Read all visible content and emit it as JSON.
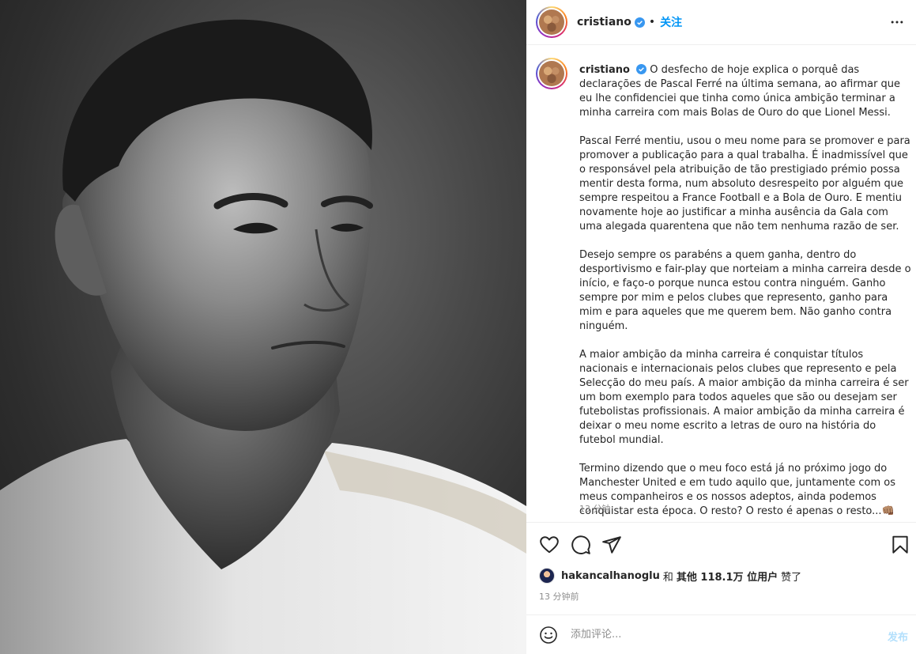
{
  "photo": {
    "alt_icon": "portrait-photo"
  },
  "header": {
    "username": "cristiano",
    "separator": "•",
    "follow_label": "关注",
    "more_icon": "more-horizontal-icon",
    "verified_icon": "verified-badge-icon"
  },
  "caption": {
    "username": "cristiano",
    "paragraphs": [
      "O desfecho de hoje explica o porquê das declarações de Pascal Ferré na última semana, ao afirmar que eu lhe confidenciei que tinha como única ambição terminar a minha carreira com mais Bolas de Ouro do que Lionel Messi.",
      "Pascal Ferré mentiu, usou o meu nome para se promover e para promover a publicação para a qual trabalha. É inadmissível que o responsável pela atribuição de tão prestigiado prémio possa mentir desta forma, num absoluto desrespeito por alguém que sempre respeitou a France Football e a Bola de Ouro. E mentiu novamente hoje ao justificar a minha ausência da Gala com uma alegada quarentena que não tem nenhuma razão de ser.",
      "Desejo sempre os parabéns a quem ganha, dentro do desportivismo e fair-play que norteiam a minha carreira desde o início, e faço-o porque nunca estou contra ninguém. Ganho sempre por mim e pelos clubes que represento, ganho para mim e para aqueles que me querem bem. Não ganho contra ninguém.",
      "A maior ambição da minha carreira é conquistar títulos nacionais e internacionais pelos clubes que represento e pela Selecção do meu país. A maior ambição da minha carreira é ser um bom exemplo para todos aqueles que são ou desejam ser futebolistas profissionais. A maior ambição da minha carreira é deixar o meu nome escrito a letras de ouro na história do futebol mundial.",
      "Termino dizendo que o meu foco está já no próximo jogo do Manchester United e em tudo aquilo que, juntamente com os meus companheiros e os nossos adeptos, ainda podemos conquistar esta época. O resto? O resto é apenas o resto...👊🏽"
    ],
    "time": "13 分钟"
  },
  "actions": {
    "like_icon": "heart-icon",
    "comment_icon": "comment-icon",
    "share_icon": "send-icon",
    "save_icon": "bookmark-icon"
  },
  "likes": {
    "liker": "hakancalhanoglu",
    "and": "和",
    "others_label": "其他 118.1万 位用户",
    "liked": "赞了"
  },
  "posted_time": "13 分钟前",
  "comment": {
    "emoji_icon": "emoji-icon",
    "placeholder": "添加评论...",
    "post_label": "发布"
  }
}
